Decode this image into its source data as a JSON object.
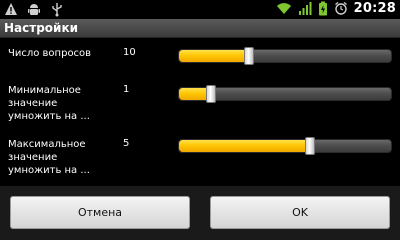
{
  "status_bar": {
    "time": "20:28",
    "icons_left": [
      "warning-icon",
      "android-icon",
      "usb-icon"
    ],
    "icons_right": [
      "wifi-icon",
      "signal-icon",
      "battery-icon",
      "alarm-icon"
    ],
    "accent_color": "#7ec72e"
  },
  "title": "Настройки",
  "settings": [
    {
      "label": "Число вопросов",
      "value": "10",
      "level": 0.33
    },
    {
      "label": "Минимальное значение умножить на ...",
      "value": "1",
      "level": 0.15
    },
    {
      "label": "Максимальное значение умножить на ...",
      "value": "5",
      "level": 0.62
    }
  ],
  "buttons": {
    "cancel": "Отмена",
    "ok": "OK"
  },
  "colors": {
    "slider_fill": "#ffc400",
    "background": "#000000"
  }
}
